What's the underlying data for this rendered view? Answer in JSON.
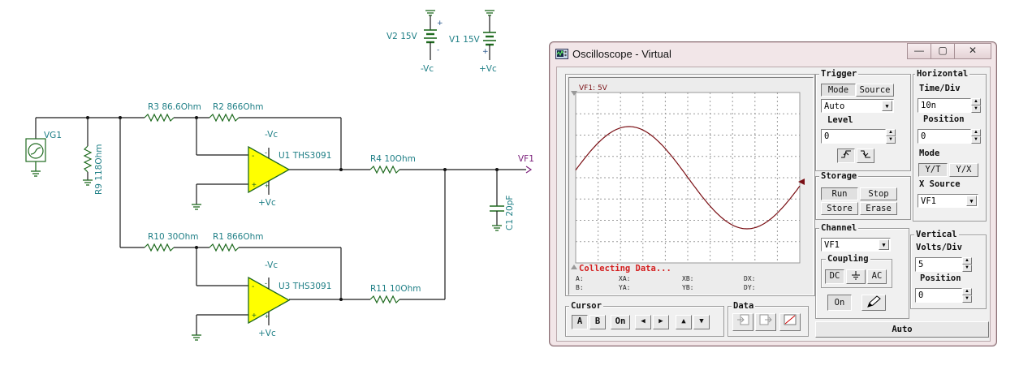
{
  "schematic": {
    "labels": {
      "vg1": "VG1",
      "r9": "R9 118Ohm",
      "r3": "R3 86.6Ohm",
      "r2": "R2 866Ohm",
      "u1_neg": "-Vc",
      "u1": "U1 THS3091",
      "u1_pos": "+Vc",
      "r4": "R4 10Ohm",
      "vf1": "VF1",
      "c1": "C1 20pF",
      "r10": "R10 30Ohm",
      "r1": "R1 866Ohm",
      "u3_neg": "-Vc",
      "u3": "U3 THS3091",
      "u3_pos": "+Vc",
      "r11": "R11 10Ohm",
      "v2": "V2 15V",
      "v2_node": "-Vc",
      "v1": "V1 15V",
      "v1_node": "+Vc"
    }
  },
  "oscilloscope": {
    "title": "Oscilloscope - Virtual",
    "caption_buttons": {
      "minimize": "—",
      "maximize": "▢",
      "close": "✕"
    },
    "screen": {
      "channel_label": "VF1: 5V",
      "status": "Collecting Data...",
      "readouts": {
        "a": "A:",
        "b": "B:",
        "xa": "XA:",
        "ya": "YA:",
        "xb": "XB:",
        "yb": "YB:",
        "dx": "DX:",
        "dy": "DY:"
      },
      "trace_color": "#7a0f14",
      "status_color": "#d42020"
    },
    "trigger": {
      "title": "Trigger",
      "mode_button": "Mode",
      "source_button": "Source",
      "mode_value": "Auto",
      "level_label": "Level",
      "level_value": "0",
      "edge_up_icon": "rising-edge-icon",
      "edge_down_icon": "falling-edge-icon"
    },
    "horizontal": {
      "title": "Horizontal",
      "timediv_label": "Time/Div",
      "timediv_value": "10n",
      "position_label": "Position",
      "position_value": "0",
      "mode_label": "Mode",
      "yt_button": "Y/T",
      "yx_button": "Y/X",
      "xsource_label": "X Source",
      "xsource_value": "VF1"
    },
    "storage": {
      "title": "Storage",
      "run": "Run",
      "stop": "Stop",
      "store": "Store",
      "erase": "Erase"
    },
    "channel": {
      "title": "Channel",
      "value": "VF1",
      "coupling_title": "Coupling",
      "dc": "DC",
      "ac": "AC",
      "on": "On"
    },
    "vertical": {
      "title": "Vertical",
      "voltsdiv_label": "Volts/Div",
      "voltsdiv_value": "5",
      "position_label": "Position",
      "position_value": "0"
    },
    "cursor": {
      "title": "Cursor",
      "a": "A",
      "b": "B",
      "on": "On",
      "left": "◀",
      "right": "▶",
      "up": "▲",
      "down": "▼"
    },
    "data": {
      "title": "Data"
    },
    "auto": "Auto"
  }
}
